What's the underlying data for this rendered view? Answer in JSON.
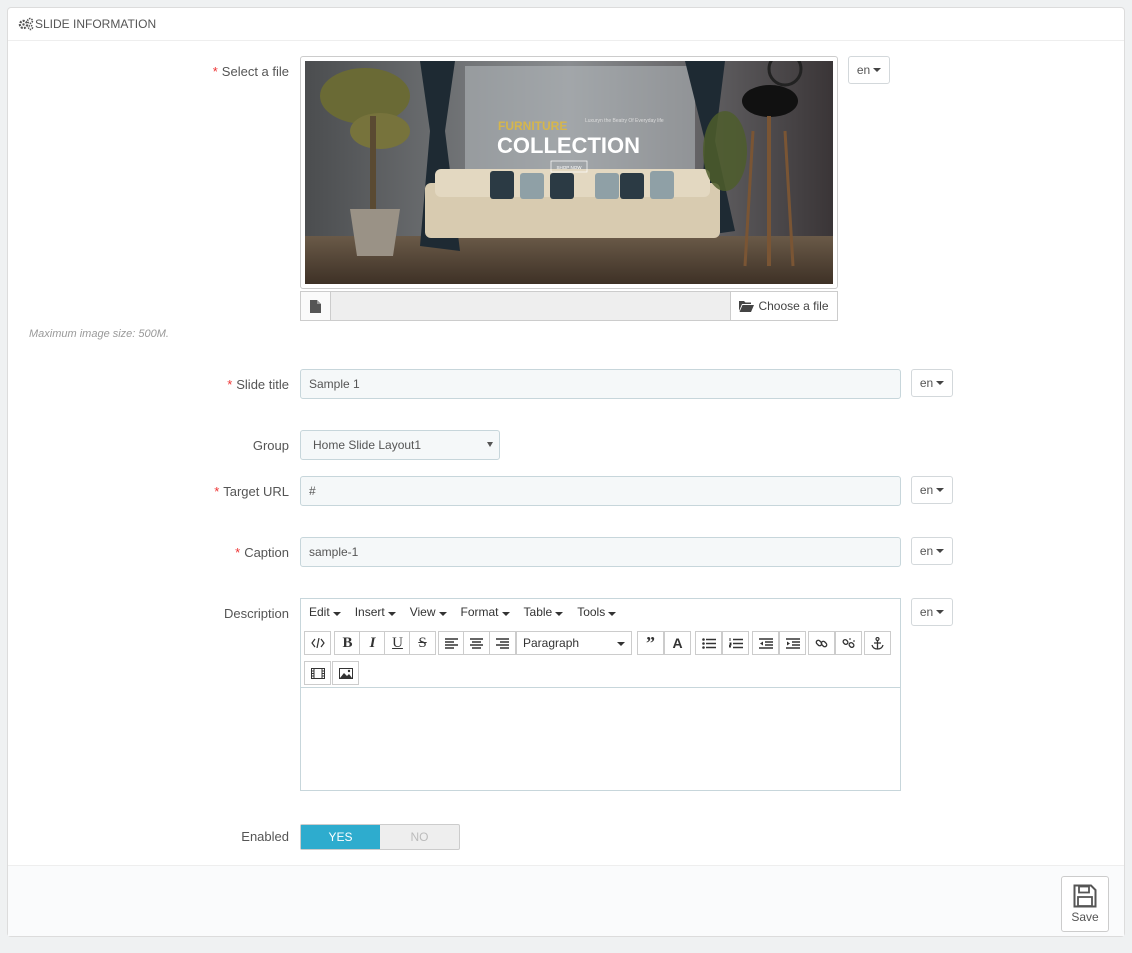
{
  "panel": {
    "title": "SLIDE INFORMATION"
  },
  "file": {
    "label": "Select a file",
    "lang": "en",
    "choose_label": "Choose a file",
    "help": "Maximum image size: 500M.",
    "preview": {
      "brand_line": "FURNITURE",
      "headline": "COLLECTION",
      "tagline": "Luxuryn the Beatry Of Everyday life",
      "button": "SHOP NOW"
    }
  },
  "slide_title": {
    "label": "Slide title",
    "value": "Sample 1",
    "lang": "en"
  },
  "group": {
    "label": "Group",
    "selected": "Home Slide Layout1"
  },
  "target_url": {
    "label": "Target URL",
    "value": "#",
    "lang": "en"
  },
  "caption": {
    "label": "Caption",
    "value": "sample-1",
    "lang": "en"
  },
  "description": {
    "label": "Description",
    "lang": "en",
    "menus": [
      "Edit",
      "Insert",
      "View",
      "Format",
      "Table",
      "Tools"
    ],
    "format_select": "Paragraph",
    "toolbar_icons": [
      "source-code-icon",
      "bold-icon",
      "italic-icon",
      "underline-icon",
      "strikethrough-icon",
      "align-left-icon",
      "align-center-icon",
      "align-right-icon",
      "blockquote-icon",
      "text-color-icon",
      "bullet-list-icon",
      "numbered-list-icon",
      "outdent-icon",
      "indent-icon",
      "link-icon",
      "unlink-icon",
      "anchor-icon",
      "media-icon",
      "image-icon"
    ]
  },
  "enabled": {
    "label": "Enabled",
    "yes": "YES",
    "no": "NO",
    "value": "YES"
  },
  "footer": {
    "save_label": "Save"
  },
  "colors": {
    "accent": "#2eacce",
    "required": "#e33333",
    "input_bg": "#f5f8f9"
  }
}
